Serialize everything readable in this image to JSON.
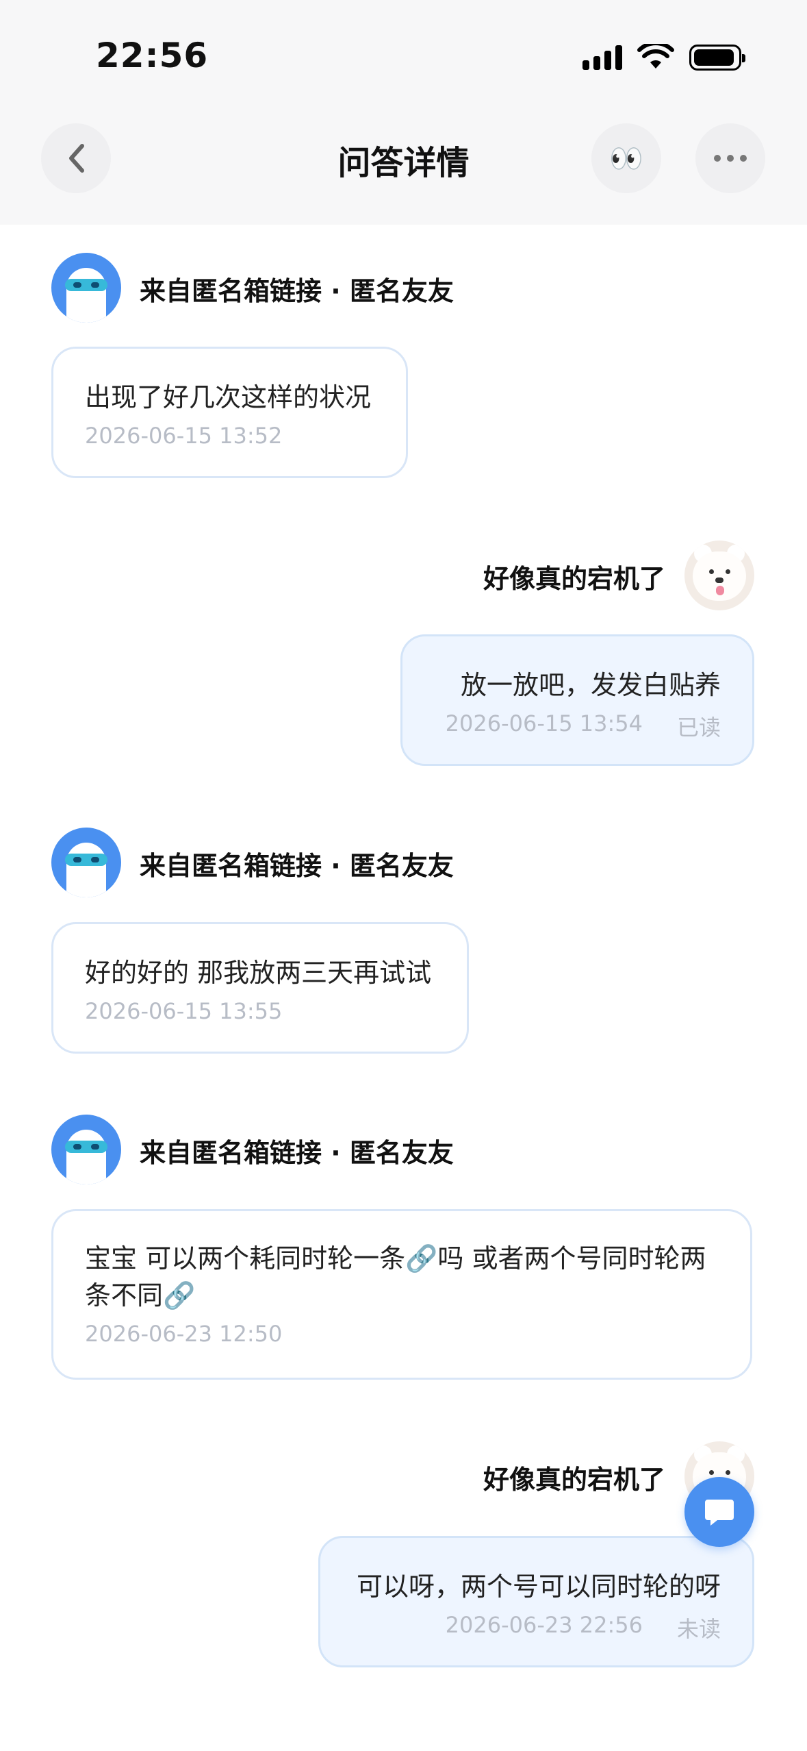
{
  "status": {
    "time": "22:56"
  },
  "nav": {
    "title": "问答详情",
    "eyes": "👀"
  },
  "messages": [
    {
      "sender": "来自匿名箱链接 · 匿名友友",
      "text": "出现了好几次这样的状况",
      "time": "2026-06-15 13:52"
    },
    {
      "sender": "好像真的宕机了",
      "text": "放一放吧，发发白贴养",
      "time": "2026-06-15 13:54",
      "status": "已读"
    },
    {
      "sender": "来自匿名箱链接 · 匿名友友",
      "text": "好的好的 那我放两三天再试试",
      "time": "2026-06-15 13:55"
    },
    {
      "sender": "来自匿名箱链接 · 匿名友友",
      "text": "宝宝 可以两个耗同时轮一条🔗吗 或者两个号同时轮两条不同🔗",
      "time": "2026-06-23 12:50"
    },
    {
      "sender": "好像真的宕机了",
      "text": "可以呀，两个号可以同时轮的呀",
      "time": "2026-06-23 22:56",
      "status": "未读"
    }
  ],
  "colors": {
    "accent": "#4a90f0",
    "bubble_border": "#d9e6f7",
    "mine_bg": "#eef5ff",
    "meta": "#b7bcc6"
  }
}
